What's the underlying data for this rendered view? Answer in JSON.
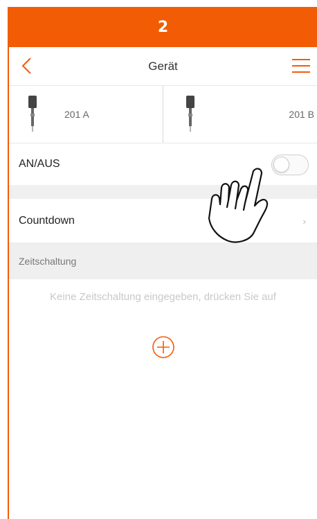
{
  "step": "2",
  "header": {
    "title": "Gerät",
    "back_icon": "chevron-left-icon",
    "menu_icon": "hamburger-menu-icon"
  },
  "devices": [
    {
      "label": "201 A",
      "icon": "plug-icon"
    },
    {
      "label": "201 B",
      "icon": "plug-icon"
    }
  ],
  "power": {
    "label": "AN/AUS",
    "state": "off"
  },
  "countdown": {
    "label": "Countdown",
    "chevron": "›"
  },
  "timer": {
    "section_label": "Zeitschaltung",
    "empty_hint": "Keine Zeitschaltung eingegeben, drücken Sie auf",
    "add_icon": "plus-circle-icon"
  },
  "colors": {
    "accent": "#f25c05",
    "section_bg": "#efefef",
    "hint_text": "#c8c8c8"
  },
  "annotation": {
    "icon": "pointing-hand-icon"
  }
}
